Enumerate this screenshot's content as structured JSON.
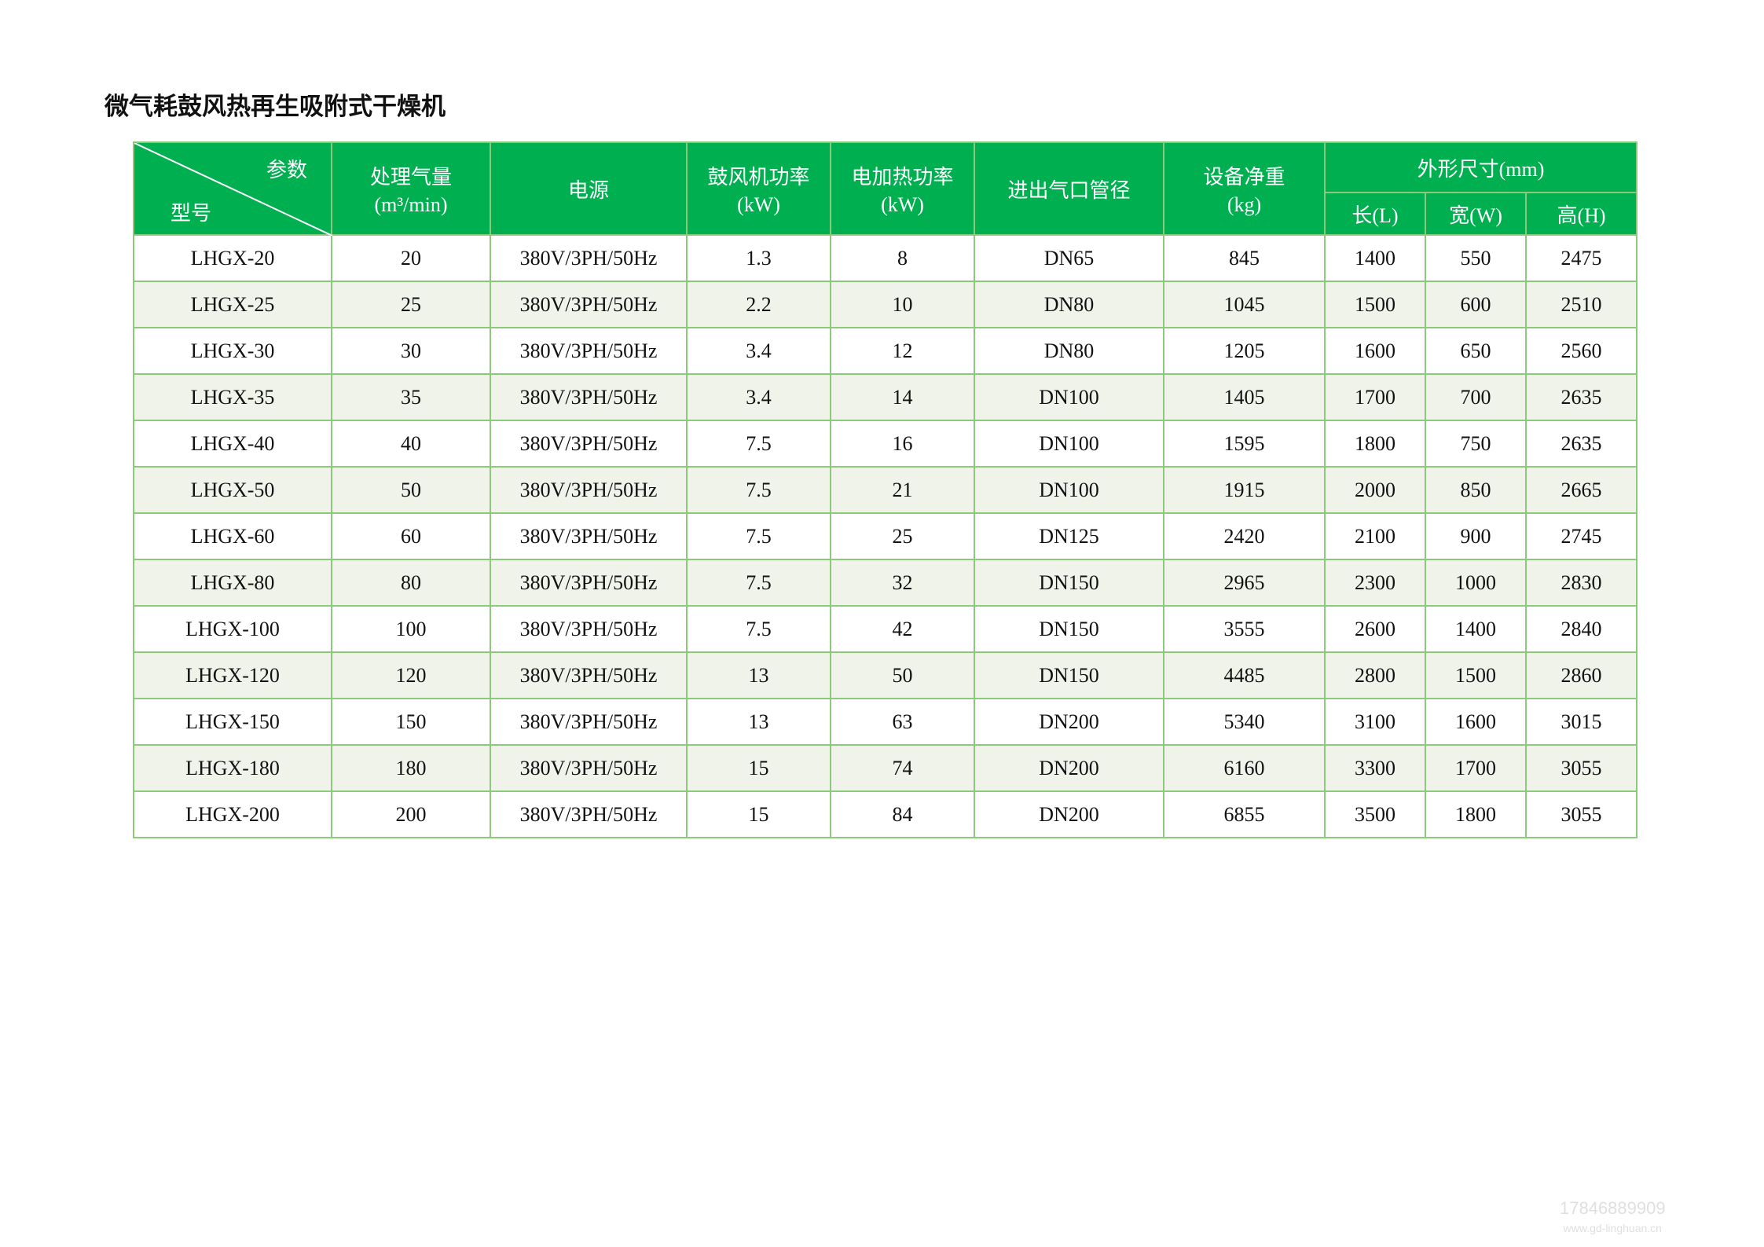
{
  "title": "微气耗鼓风热再生吸附式干燥机",
  "header": {
    "diag_top": "参数",
    "diag_bottom": "型号",
    "flow": "处理气量",
    "flow_unit": "(m³/min)",
    "power": "电源",
    "blower": "鼓风机功率",
    "blower_unit": "(kW)",
    "heater": "电加热功率",
    "heater_unit": "(kW)",
    "pipe": "进出气口管径",
    "weight": "设备净重",
    "weight_unit": "(kg)",
    "dims": "外形尺寸(mm)",
    "len": "长(L)",
    "wid": "宽(W)",
    "hei": "高(H)"
  },
  "rows": [
    [
      "LHGX-20",
      "20",
      "380V/3PH/50Hz",
      "1.3",
      "8",
      "DN65",
      "845",
      "1400",
      "550",
      "2475"
    ],
    [
      "LHGX-25",
      "25",
      "380V/3PH/50Hz",
      "2.2",
      "10",
      "DN80",
      "1045",
      "1500",
      "600",
      "2510"
    ],
    [
      "LHGX-30",
      "30",
      "380V/3PH/50Hz",
      "3.4",
      "12",
      "DN80",
      "1205",
      "1600",
      "650",
      "2560"
    ],
    [
      "LHGX-35",
      "35",
      "380V/3PH/50Hz",
      "3.4",
      "14",
      "DN100",
      "1405",
      "1700",
      "700",
      "2635"
    ],
    [
      "LHGX-40",
      "40",
      "380V/3PH/50Hz",
      "7.5",
      "16",
      "DN100",
      "1595",
      "1800",
      "750",
      "2635"
    ],
    [
      "LHGX-50",
      "50",
      "380V/3PH/50Hz",
      "7.5",
      "21",
      "DN100",
      "1915",
      "2000",
      "850",
      "2665"
    ],
    [
      "LHGX-60",
      "60",
      "380V/3PH/50Hz",
      "7.5",
      "25",
      "DN125",
      "2420",
      "2100",
      "900",
      "2745"
    ],
    [
      "LHGX-80",
      "80",
      "380V/3PH/50Hz",
      "7.5",
      "32",
      "DN150",
      "2965",
      "2300",
      "1000",
      "2830"
    ],
    [
      "LHGX-100",
      "100",
      "380V/3PH/50Hz",
      "7.5",
      "42",
      "DN150",
      "3555",
      "2600",
      "1400",
      "2840"
    ],
    [
      "LHGX-120",
      "120",
      "380V/3PH/50Hz",
      "13",
      "50",
      "DN150",
      "4485",
      "2800",
      "1500",
      "2860"
    ],
    [
      "LHGX-150",
      "150",
      "380V/3PH/50Hz",
      "13",
      "63",
      "DN200",
      "5340",
      "3100",
      "1600",
      "3015"
    ],
    [
      "LHGX-180",
      "180",
      "380V/3PH/50Hz",
      "15",
      "74",
      "DN200",
      "6160",
      "3300",
      "1700",
      "3055"
    ],
    [
      "LHGX-200",
      "200",
      "380V/3PH/50Hz",
      "15",
      "84",
      "DN200",
      "6855",
      "3500",
      "1800",
      "3055"
    ]
  ],
  "watermark": {
    "phone": "17846889909",
    "site": "www.gd-linghuan.cn"
  },
  "colors": {
    "header_bg": "#00b050",
    "border": "#8cc97a",
    "stripe": "#eff3ea"
  }
}
